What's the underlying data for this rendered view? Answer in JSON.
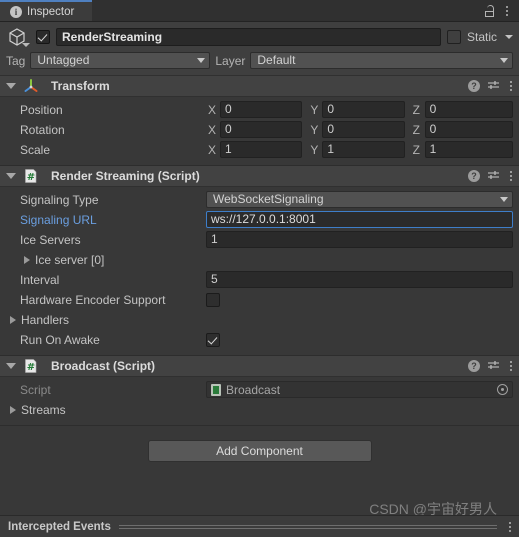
{
  "window": {
    "tab_label": "Inspector",
    "tab_icon": "info-icon",
    "lock_icon": "lock-open-icon",
    "menu_icon": "kebab-menu-icon"
  },
  "gameobject": {
    "icon": "cube-icon",
    "enabled": true,
    "name": "RenderStreaming",
    "static_label": "Static",
    "static_checked": false,
    "tag_label": "Tag",
    "tag_value": "Untagged",
    "layer_label": "Layer",
    "layer_value": "Default"
  },
  "components": [
    {
      "title": "Transform",
      "icon": "transform-gizmo-icon",
      "expanded": true,
      "rows": [
        {
          "label": "Position",
          "type": "vector3",
          "axes": [
            "X",
            "Y",
            "Z"
          ],
          "values": [
            "0",
            "0",
            "0"
          ]
        },
        {
          "label": "Rotation",
          "type": "vector3",
          "axes": [
            "X",
            "Y",
            "Z"
          ],
          "values": [
            "0",
            "0",
            "0"
          ]
        },
        {
          "label": "Scale",
          "type": "vector3",
          "axes": [
            "X",
            "Y",
            "Z"
          ],
          "values": [
            "1",
            "1",
            "1"
          ]
        }
      ]
    },
    {
      "title": "Render Streaming (Script)",
      "icon": "csharp-script-icon",
      "expanded": true,
      "rows": [
        {
          "label": "Signaling Type",
          "type": "dropdown",
          "value": "WebSocketSignaling"
        },
        {
          "label": "Signaling URL",
          "type": "text",
          "value": "ws://127.0.0.1:8001",
          "focused": true,
          "label_modified": true
        },
        {
          "label": "Ice Servers",
          "type": "text",
          "value": "1"
        },
        {
          "label": "Ice server [0]",
          "type": "foldout",
          "expanded": false,
          "indent": 2
        },
        {
          "label": "Interval",
          "type": "text",
          "value": "5"
        },
        {
          "label": "Hardware Encoder Support",
          "type": "checkbox",
          "checked": false
        },
        {
          "label": "Handlers",
          "type": "foldout",
          "expanded": false,
          "indent": 1
        },
        {
          "label": "Run On Awake",
          "type": "checkbox",
          "checked": true
        }
      ]
    },
    {
      "title": "Broadcast (Script)",
      "icon": "csharp-script-icon",
      "expanded": true,
      "rows": [
        {
          "label": "Script",
          "type": "object",
          "value": "Broadcast",
          "readonly": true
        },
        {
          "label": "Streams",
          "type": "foldout",
          "expanded": false,
          "indent": 1
        }
      ]
    }
  ],
  "comp_tools": {
    "help_label": "?",
    "help_icon": "help-icon",
    "preset_icon": "preset-settings-icon",
    "menu_icon": "kebab-menu-icon"
  },
  "add_component": {
    "label": "Add Component"
  },
  "footer": {
    "title": "Intercepted Events",
    "menu_icon": "kebab-menu-icon"
  },
  "watermark": {
    "text": "CSDN @宇宙好男人"
  },
  "colors": {
    "accent_blue": "#4f80c0",
    "focus_border": "#3e7ec9",
    "modified_label": "#6b9fe0",
    "panel_bg": "#383838",
    "header_bg": "#424242",
    "field_bg": "#2a2a2a"
  }
}
